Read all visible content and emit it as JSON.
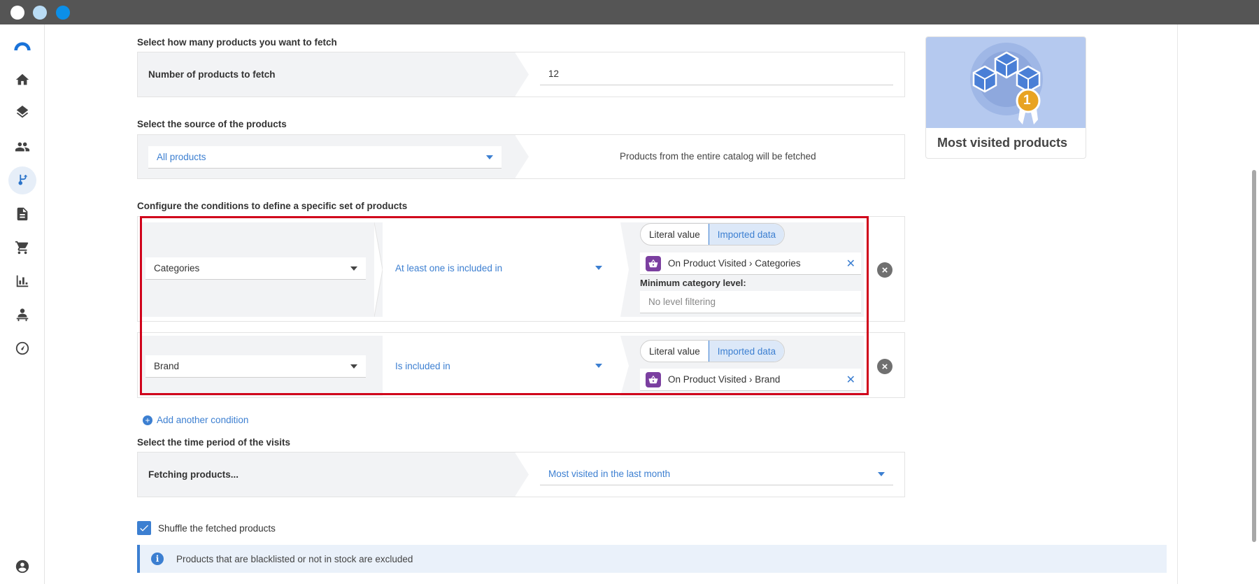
{
  "sections": {
    "fetch_count_label": "Select how many products you want to fetch",
    "source_label": "Select the source of the products",
    "conditions_label": "Configure the conditions to define a specific set of products",
    "time_period_label": "Select the time period of the visits"
  },
  "fetch_count": {
    "label": "Number of products to fetch",
    "value": "12"
  },
  "source": {
    "selected": "All products",
    "description": "Products from the entire catalog will be fetched"
  },
  "conditions": [
    {
      "attribute": "Categories",
      "operator": "At least one is included in",
      "toggle_literal": "Literal value",
      "toggle_imported": "Imported data",
      "value": "On Product Visited › Categories",
      "min_level_label": "Minimum category level:",
      "min_level_placeholder": "No level filtering"
    },
    {
      "attribute": "Brand",
      "operator": "Is included in",
      "toggle_literal": "Literal value",
      "toggle_imported": "Imported data",
      "value": "On Product Visited › Brand"
    }
  ],
  "add_condition_label": "Add another condition",
  "time_period": {
    "label": "Fetching products...",
    "selected": "Most visited in the last month"
  },
  "shuffle_label": "Shuffle the fetched products",
  "shuffle_checked": true,
  "info_text": "Products that are blacklisted or not in stock are excluded",
  "template_card": {
    "title": "Most visited products",
    "badge_number": "1"
  },
  "colors": {
    "accent": "#3c7fd1",
    "highlight": "#d0021b",
    "imported_badge": "#7b3fa0"
  }
}
